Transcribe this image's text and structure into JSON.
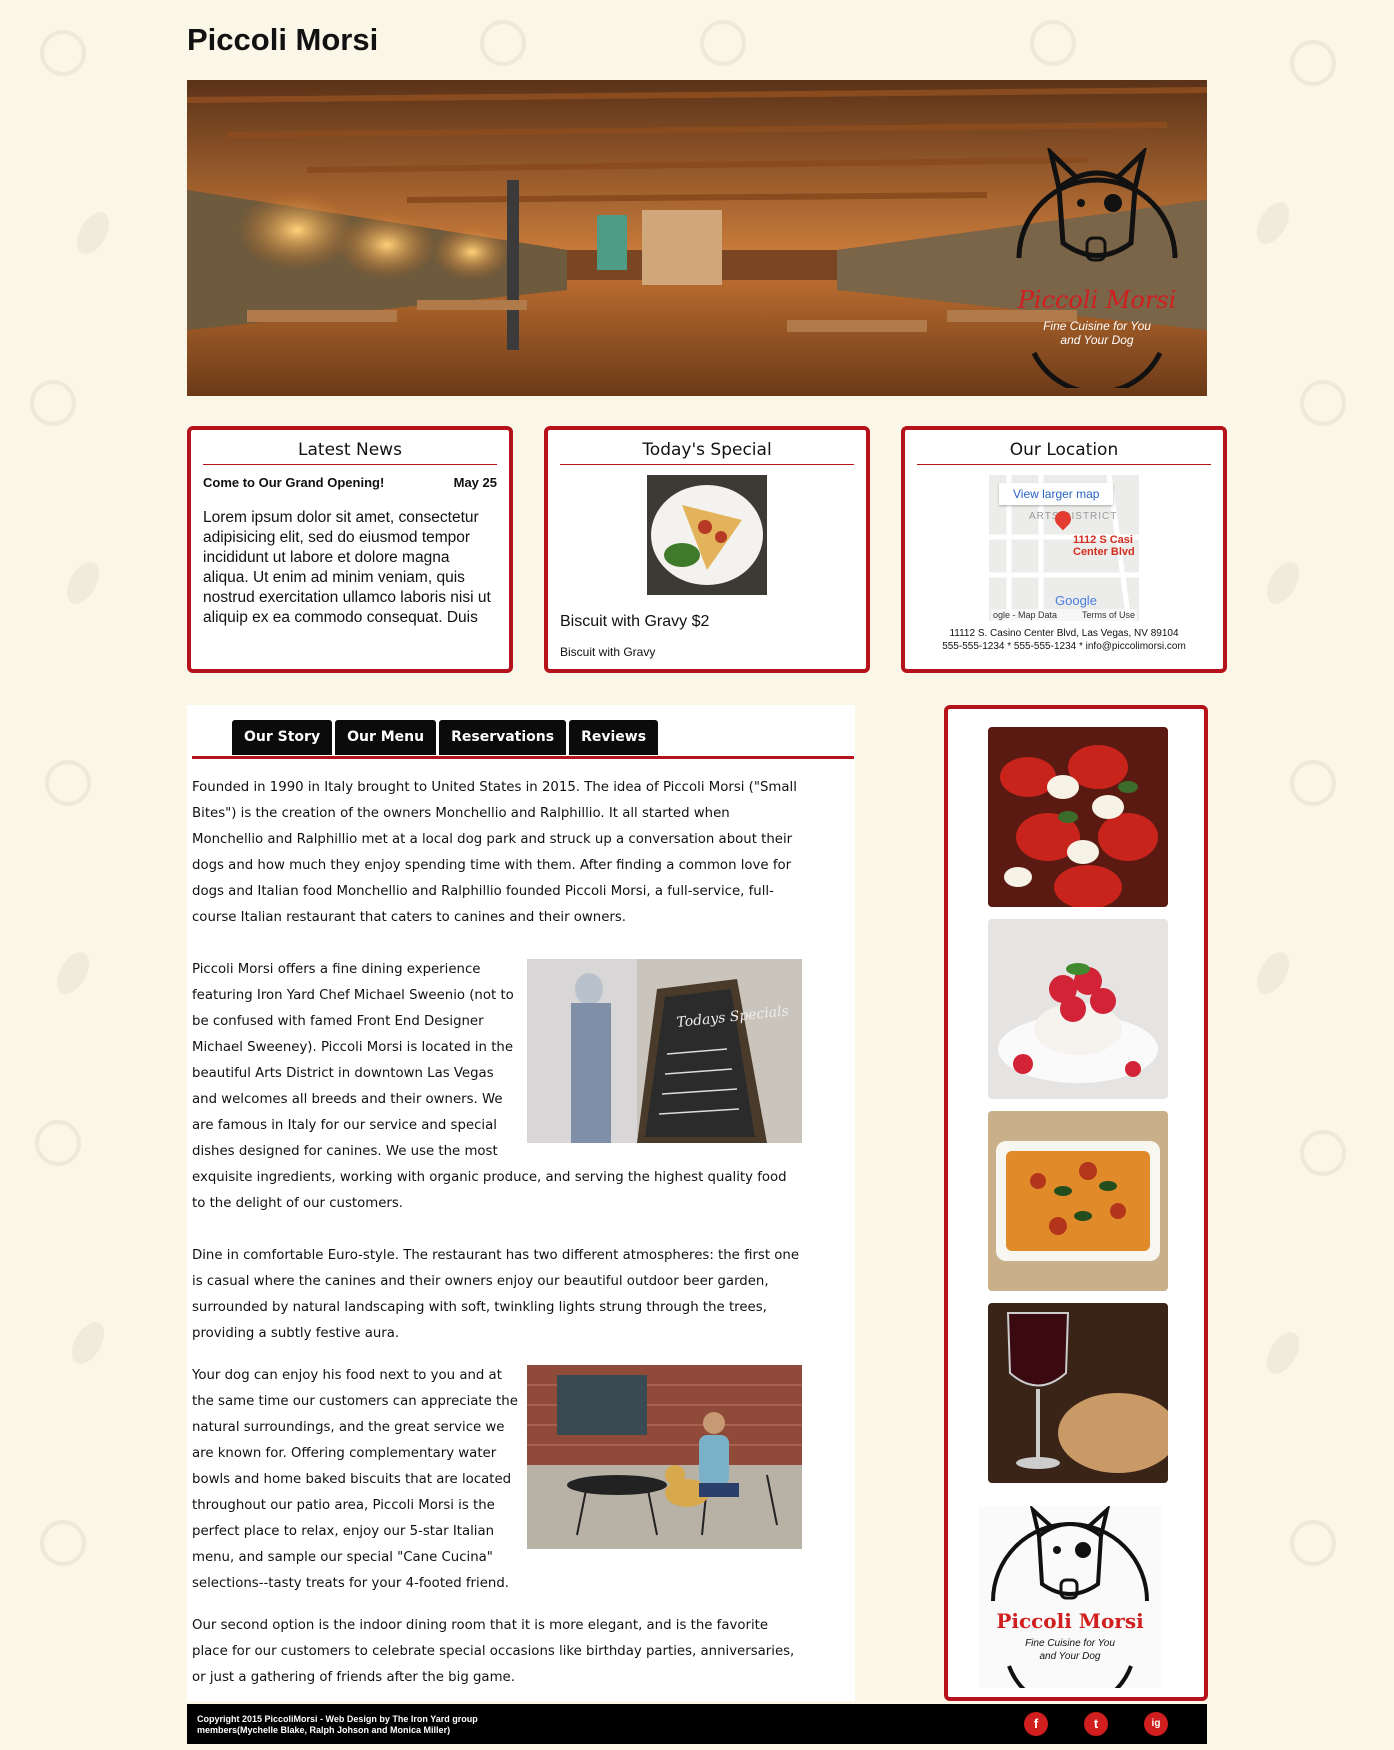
{
  "site": {
    "title": "Piccoli Morsi"
  },
  "hero": {
    "logo_name": "Piccoli Morsi",
    "logo_tagline_1": "Fine Cuisine for You",
    "logo_tagline_2": "and Your Dog"
  },
  "news": {
    "heading": "Latest News",
    "item_title": "Come to Our Grand Opening!",
    "item_date": "May 25",
    "item_body": "Lorem ipsum dolor sit amet, consectetur adipisicing elit, sed do eiusmod tempor incididunt ut labore et dolore magna aliqua. Ut enim ad minim veniam, quis nostrud exercitation ullamco laboris nisi ut aliquip ex ea commodo consequat. Duis aute irure dolor in reprehenderit in"
  },
  "special": {
    "heading": "Today's Special",
    "title": "Biscuit with Gravy $2",
    "description": "Biscuit with Gravy"
  },
  "location": {
    "heading": "Our Location",
    "map_button": "View larger map",
    "map_pin_label_1": "1112 S Casi",
    "map_pin_label_2": "Center Blvd",
    "map_district": "ARTS DISTRICT",
    "map_google": "Google",
    "map_footer_left": "ogle - Map Data",
    "map_footer_right": "Terms of Use",
    "address": "11112 S. Casino Center Blvd, Las Vegas, NV 89104",
    "contact": "555-555-1234 * 555-555-1234 * info@piccolimorsi.com"
  },
  "tabs": [
    "Our Story",
    "Our Menu",
    "Reservations",
    "Reviews"
  ],
  "story": {
    "p1": "Founded in 1990 in Italy brought to United States in 2015. The idea of Piccoli Morsi (\"Small Bites\") is the creation of the owners Monchellio and Ralphillio. It all started when Monchellio and Ralphillio met at a local dog park and struck up a conversation about their dogs and how much they enjoy spending time with them. After finding a common love for dogs and Italian food Monchellio and Ralphillio founded Piccoli Morsi, a full-service, full-course Italian restaurant that caters to canines and their owners.",
    "p2": "Piccoli Morsi offers a fine dining experience featuring Iron Yard Chef Michael Sweenio (not to be confused with famed Front End Designer Michael Sweeney). Piccoli Morsi is located in the beautiful Arts District in downtown Las Vegas and welcomes all breeds and their owners. We are famous in Italy for our service and special dishes designed for canines. We use the most exquisite ingredients, working with organic produce, and serving the highest quality food to the delight of our customers.",
    "p3": "Dine in comfortable Euro-style. The restaurant has two different atmospheres: the first one is casual where the canines and their owners enjoy our beautiful outdoor beer garden, surrounded by natural landscaping with soft, twinkling lights strung through the trees, providing a subtly festive aura.",
    "p4": "Your dog can enjoy his food next to you and at the same time our customers can appreciate the natural surroundings, and the great service we are known for. Offering complementary water bowls and home baked biscuits that are located throughout our patio area, Piccoli Morsi is the perfect place to relax, enjoy our 5-star Italian menu, and sample our special \"Cane Cucina\" selections--tasty treats for your 4-footed friend.",
    "p5": "Our second option is the indoor dining room that it is more elegant, and is the favorite place for our customers to celebrate special occasions like birthday parties, anniversaries, or just a gathering of friends after the big game.",
    "chalkboard_text": "Todays Specials"
  },
  "gallery": {
    "logo_name": "Piccoli Morsi",
    "logo_tagline_1": "Fine Cuisine for You",
    "logo_tagline_2": "and Your Dog"
  },
  "footer": {
    "line1": "Copyright 2015 PiccoliMorsi - Web Design by The Iron Yard group",
    "line2": "members(Mychelle Blake, Ralph Johson and Monica Miller)",
    "facebook": "f",
    "twitter": "t",
    "instagram": "ig"
  },
  "colors": {
    "accent": "#b5121b",
    "background": "#faf6e8",
    "footer": "#000000"
  }
}
